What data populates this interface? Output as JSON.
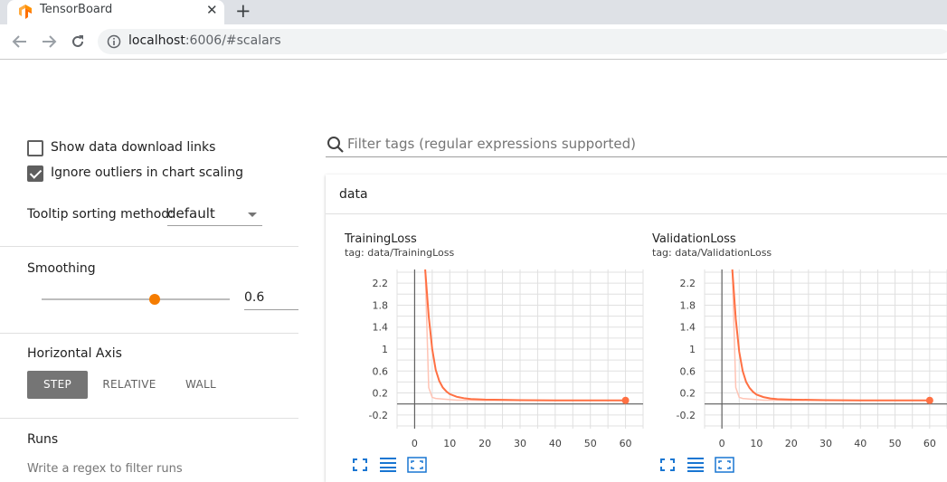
{
  "browser": {
    "tab_title": "TensorBoard",
    "close_glyph": "✕",
    "new_tab_glyph": "+",
    "url_host": "localhost",
    "url_rest": ":6006/#scalars",
    "icons": [
      "back-arrow-icon",
      "forward-arrow-icon",
      "reload-icon",
      "info-icon",
      "tensorflow-logo-icon"
    ]
  },
  "sidebar": {
    "show_download_label": "Show data download links",
    "show_download_checked": false,
    "ignore_outliers_label": "Ignore outliers in chart scaling",
    "ignore_outliers_checked": true,
    "tooltip_sort_label": "Tooltip sorting method:",
    "tooltip_sort_value": "default",
    "smoothing_label": "Smoothing",
    "smoothing_value": "0.6",
    "smoothing_fraction": 0.6,
    "horizontal_axis_label": "Horizontal Axis",
    "axis_options": [
      "STEP",
      "RELATIVE",
      "WALL"
    ],
    "axis_selected": "STEP",
    "runs_label": "Runs",
    "runs_placeholder": "Write a regex to filter runs"
  },
  "main": {
    "filter_placeholder": "Filter tags (regular expressions supported)",
    "card_title": "data"
  },
  "colors": {
    "accent_orange": "#f57c00",
    "series_line": "#ff7043",
    "series_raw": "#ffc4b5",
    "active_button": "#757575",
    "icon_blue": "#1976d2"
  },
  "chart_data": [
    {
      "type": "line",
      "title": "TrainingLoss",
      "subtitle": "tag: data/TrainingLoss",
      "x_ticks": [
        0,
        10,
        20,
        30,
        40,
        50,
        60
      ],
      "y_ticks": [
        "-0.2",
        "0.2",
        "0.6",
        "1",
        "1.4",
        "1.8",
        "2.2"
      ],
      "xlim": [
        -5,
        65
      ],
      "ylim": [
        -0.45,
        2.45
      ],
      "grid": true,
      "series": [
        {
          "smoothed": true,
          "x": [
            3,
            4,
            5,
            6,
            7,
            8,
            9,
            10,
            12,
            14,
            16,
            20,
            25,
            30,
            40,
            50,
            60
          ],
          "y": [
            2.45,
            1.6,
            1.0,
            0.62,
            0.42,
            0.3,
            0.23,
            0.18,
            0.13,
            0.105,
            0.09,
            0.08,
            0.075,
            0.07,
            0.065,
            0.065,
            0.065
          ]
        },
        {
          "smoothed": false,
          "x": [
            3,
            4,
            5,
            6,
            8,
            10,
            12,
            16,
            20,
            30,
            40,
            50,
            60
          ],
          "y": [
            2.45,
            0.3,
            0.12,
            0.1,
            0.09,
            0.08,
            0.07,
            0.07,
            0.065,
            0.065,
            0.065,
            0.065,
            0.065
          ]
        }
      ],
      "last_point": [
        60,
        0.065
      ]
    },
    {
      "type": "line",
      "title": "ValidationLoss",
      "subtitle": "tag: data/ValidationLoss",
      "x_ticks": [
        0,
        10,
        20,
        30,
        40,
        50,
        60
      ],
      "y_ticks": [
        "-0.2",
        "0.2",
        "0.6",
        "1",
        "1.4",
        "1.8",
        "2.2"
      ],
      "xlim": [
        -5,
        65
      ],
      "ylim": [
        -0.45,
        2.45
      ],
      "grid": true,
      "series": [
        {
          "smoothed": true,
          "x": [
            3,
            4,
            5,
            6,
            7,
            8,
            9,
            10,
            12,
            14,
            16,
            20,
            25,
            30,
            40,
            50,
            60
          ],
          "y": [
            2.45,
            1.55,
            0.95,
            0.6,
            0.4,
            0.29,
            0.22,
            0.17,
            0.125,
            0.1,
            0.088,
            0.08,
            0.075,
            0.07,
            0.065,
            0.065,
            0.065
          ]
        },
        {
          "smoothed": false,
          "x": [
            3,
            4,
            5,
            6,
            8,
            10,
            12,
            16,
            20,
            30,
            40,
            50,
            60
          ],
          "y": [
            2.45,
            0.3,
            0.12,
            0.1,
            0.09,
            0.08,
            0.07,
            0.07,
            0.065,
            0.065,
            0.065,
            0.065,
            0.065
          ]
        }
      ],
      "last_point": [
        60,
        0.065
      ]
    }
  ]
}
